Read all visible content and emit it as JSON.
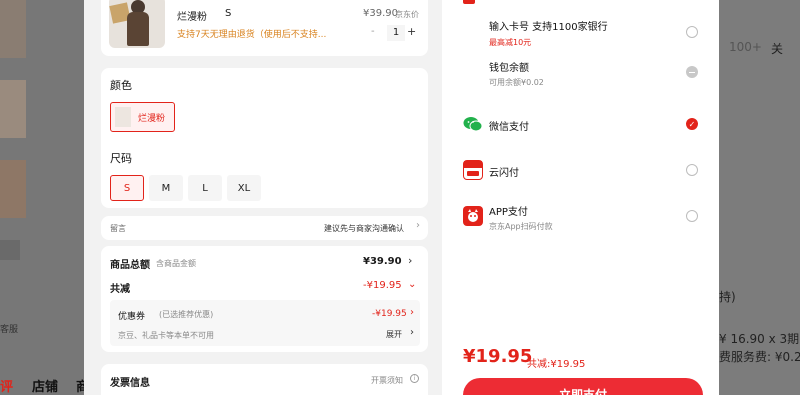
{
  "background": {
    "bottom_tabs": [
      "评",
      "店铺",
      "商"
    ],
    "right_texts": [
      "100+",
      "关",
      "持)",
      "¥ 16.90 x 3期",
      "费服务费: ¥0.25/"
    ],
    "left_text": "客服"
  },
  "product": {
    "variant": "烂漫粉",
    "size": "S",
    "price": "¥39.90",
    "price_suffix": "京东价",
    "return_policy": "支持7天无理由退货（使用后不支持...",
    "quantity": "1",
    "minus": "-",
    "plus": "+"
  },
  "color_section": {
    "title": "颜色",
    "options": [
      "烂漫粉"
    ]
  },
  "size_section": {
    "title": "尺码",
    "options": [
      "S",
      "M",
      "L",
      "XL"
    ],
    "selected": "S"
  },
  "note": {
    "label": "留言",
    "hint": "建议先与商家沟通确认"
  },
  "totals": {
    "goods_total_label": "商品总额",
    "goods_total_sub": "含商品金额",
    "goods_total_value": "¥39.90",
    "reduce_label": "共减",
    "reduce_value": "-¥19.95",
    "coupon_label": "优惠券",
    "coupon_sub": "(已选推荐优惠)",
    "coupon_value": "-¥19.95",
    "other_label": "京豆、礼品卡等本单不可用",
    "expand": "展开"
  },
  "invoice": {
    "label": "发票信息",
    "hint": "开票须知"
  },
  "payment": {
    "card": {
      "title": "输入卡号 支持1100家银行",
      "promo": "最高减10元"
    },
    "wallet": {
      "title": "钱包余额",
      "sub": "可用余额¥0.02"
    },
    "wechat": {
      "title": "微信支付"
    },
    "unionpay": {
      "title": "云闪付"
    },
    "app": {
      "title": "APP支付",
      "sub": "京东App扫码付款"
    }
  },
  "footer": {
    "total": "¥19.95",
    "saved": "共减:¥19.95",
    "pay_button": "立即支付"
  },
  "colors": {
    "accent": "#e2231a",
    "wechat": "#22b14c"
  }
}
